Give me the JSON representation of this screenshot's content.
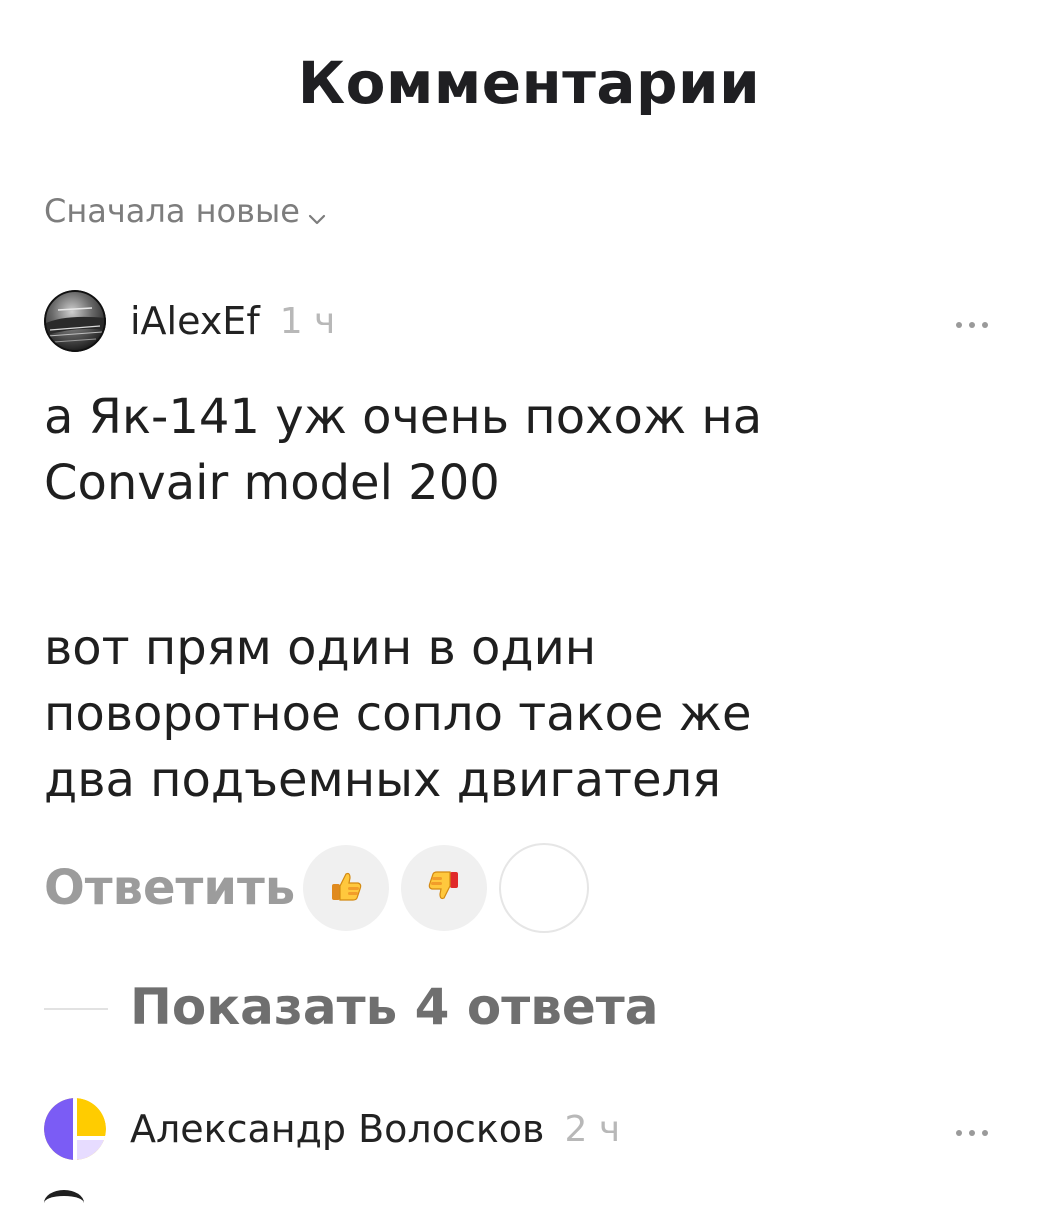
{
  "page": {
    "title": "Комментарии"
  },
  "sort": {
    "label": "Сначала новые",
    "icon": "chevron-down-icon"
  },
  "comments": [
    {
      "author": "iAlexEf",
      "time": "1 ч",
      "body_lines": [
        "а Як-141 уж очень похож на",
        "Convair model 200",
        "вот прям один в один",
        "поворотное сопло такое же",
        "два подъемных двигателя"
      ],
      "actions": {
        "reply_label": "Ответить",
        "like_icon": "thumbs-up-icon",
        "dislike_icon": "thumbs-down-icon",
        "add_reaction_icon": "add-reaction-icon"
      },
      "replies_label": "Показать 4 ответа",
      "more_icon": "more-horizontal-icon"
    },
    {
      "author": "Александр Волосков",
      "time": "2 ч",
      "more_icon": "more-horizontal-icon"
    }
  ],
  "colors": {
    "title": "#1f1f22",
    "muted": "#7d7d7d",
    "timestamp": "#b8b8b8",
    "reaction_bg": "#f0f0f0",
    "avatar2_purple": "#7b5cf5",
    "avatar2_yellow": "#ffcc00"
  }
}
